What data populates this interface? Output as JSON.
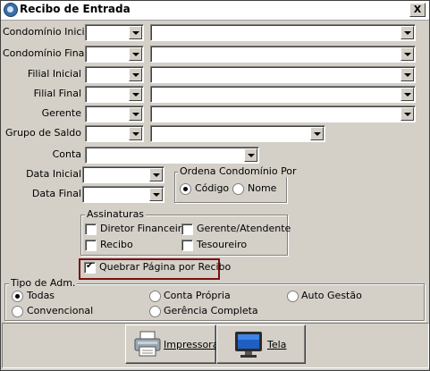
{
  "window": {
    "title": "Recibo de Entrada",
    "close_label": "X"
  },
  "fields": [
    {
      "label": "Condomínio Inicial",
      "value": "",
      "desc": ""
    },
    {
      "label": "Condomínio Final",
      "value": "",
      "desc": ""
    },
    {
      "label": "Filial Inicial",
      "value": "",
      "desc": ""
    },
    {
      "label": "Filial Final",
      "value": "",
      "desc": ""
    },
    {
      "label": "Gerente",
      "value": "",
      "desc": ""
    },
    {
      "label": "Grupo de Saldo",
      "value": "",
      "desc": ""
    },
    {
      "label": "Conta",
      "value": ""
    },
    {
      "label": "Data Inicial",
      "value": ""
    },
    {
      "label": "Data Final",
      "value": ""
    }
  ],
  "ordena": {
    "title": "Ordena Condomínio Por",
    "options": [
      {
        "label": "Código",
        "selected": true
      },
      {
        "label": "Nome",
        "selected": false
      }
    ]
  },
  "assinaturas": {
    "title": "Assinaturas",
    "items": [
      {
        "label": "Diretor Financeiro",
        "checked": false
      },
      {
        "label": "Gerente/Atendente",
        "checked": false
      },
      {
        "label": "Recibo",
        "checked": false
      },
      {
        "label": "Tesoureiro",
        "checked": false
      }
    ]
  },
  "quebrar": {
    "label": "Quebrar Página por Recibo",
    "checked": true
  },
  "tipo_adm": {
    "title": "Tipo de Adm.",
    "options": [
      {
        "label": "Todas",
        "selected": true
      },
      {
        "label": "Conta Própria",
        "selected": false
      },
      {
        "label": "Auto Gestão",
        "selected": false
      },
      {
        "label": "Convencional",
        "selected": false
      },
      {
        "label": "Gerência Completa",
        "selected": false
      }
    ]
  },
  "buttons": {
    "impressora": "Impressora",
    "tela": "Tela"
  },
  "colors": {
    "highlight": "#7b1010",
    "face": "#d4d0c8"
  }
}
